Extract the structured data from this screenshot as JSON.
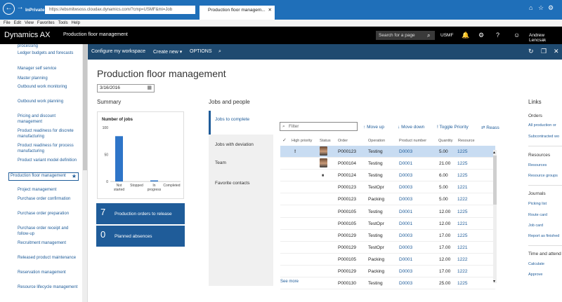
{
  "browser": {
    "inprivate": "InPrivate",
    "address": "https://ebsmitwsoss.cloudax.dynamics.com/?cmp=USMF&mi=Job",
    "tab_title": "Production floor managem...",
    "menu": [
      "File",
      "Edit",
      "View",
      "Favorites",
      "Tools",
      "Help"
    ]
  },
  "appnav": {
    "brand": "Dynamics AX",
    "page": "Production floor management",
    "search_placeholder": "Search for a page",
    "company": "USMF",
    "user": "Andrew Lencsak"
  },
  "actionpane": {
    "configure": "Configure my workspace",
    "create_new": "Create new",
    "options": "OPTIONS"
  },
  "leftnav": {
    "items": [
      "processing",
      "Ledger budgets and forecasts",
      "Manager self service",
      "Master planning",
      "Outbound work monitoring",
      "Outbound work planning",
      "Pricing and discount management",
      "Product readiness for discrete manufacturing",
      "Product readiness for process manufacturing",
      "Product variant model definition",
      "Production floor management",
      "Project management",
      "Purchase order confirmation",
      "Purchase order preparation",
      "Purchase order receipt and follow-up",
      "Recruitment management",
      "Released product maintenance",
      "Reservation management",
      "Resource lifecycle management"
    ]
  },
  "main": {
    "title": "Production floor management",
    "date": "3/16/2016",
    "summary_heading": "Summary",
    "jobs_and_people_heading": "Jobs and people"
  },
  "chart_data": {
    "type": "bar",
    "title": "Number of jobs",
    "categories": [
      "Not started",
      "Stopped",
      "In progress",
      "Completed"
    ],
    "values": [
      84,
      0,
      2,
      0
    ],
    "ylim": [
      0,
      100
    ],
    "yticks": [
      0,
      50,
      100
    ],
    "xlabel": "",
    "ylabel": "",
    "color": "#2e75c8"
  },
  "tiles": [
    {
      "count": "7",
      "label": "Production orders to release"
    },
    {
      "count": "0",
      "label": "Planned absences"
    }
  ],
  "jp_tabs": [
    "Jobs to complete",
    "Jobs with deviation",
    "Team",
    "Favorite contacts"
  ],
  "grid": {
    "filter_placeholder": "Filter",
    "actions": {
      "move_up": "Move up",
      "move_down": "Move down",
      "toggle_priority": "Toggle Priority",
      "reassign": "Reass"
    },
    "columns": [
      "High priority",
      "Status",
      "Order",
      "Operation",
      "Product number",
      "Quantity",
      "Resource"
    ],
    "rows": [
      {
        "priority": "!",
        "status": "avatar",
        "order": "P000123",
        "operation": "Testing",
        "product": "D0003",
        "qty": "5.00",
        "resource": "1225"
      },
      {
        "priority": "",
        "status": "avatar",
        "order": "P000104",
        "operation": "Testing",
        "product": "D0001",
        "qty": "21.00",
        "resource": "1225"
      },
      {
        "priority": "",
        "status": "pause",
        "order": "P000124",
        "operation": "Testing",
        "product": "D0003",
        "qty": "6.00",
        "resource": "1225"
      },
      {
        "priority": "",
        "status": "",
        "order": "P000123",
        "operation": "TestOpr",
        "product": "D0003",
        "qty": "5.00",
        "resource": "1221"
      },
      {
        "priority": "",
        "status": "",
        "order": "P000123",
        "operation": "Packing",
        "product": "D0003",
        "qty": "5.00",
        "resource": "1222"
      },
      {
        "priority": "",
        "status": "",
        "order": "P000105",
        "operation": "Testing",
        "product": "D0001",
        "qty": "12.00",
        "resource": "1225"
      },
      {
        "priority": "",
        "status": "",
        "order": "P000105",
        "operation": "TestOpr",
        "product": "D0001",
        "qty": "12.00",
        "resource": "1221"
      },
      {
        "priority": "",
        "status": "",
        "order": "P000129",
        "operation": "Testing",
        "product": "D0003",
        "qty": "17.00",
        "resource": "1225"
      },
      {
        "priority": "",
        "status": "",
        "order": "P000129",
        "operation": "TestOpr",
        "product": "D0003",
        "qty": "17.00",
        "resource": "1221"
      },
      {
        "priority": "",
        "status": "",
        "order": "P000105",
        "operation": "Packing",
        "product": "D0001",
        "qty": "12.00",
        "resource": "1222"
      },
      {
        "priority": "",
        "status": "",
        "order": "P000129",
        "operation": "Packing",
        "product": "D0003",
        "qty": "17.00",
        "resource": "1222"
      },
      {
        "priority": "",
        "status": "",
        "order": "P000130",
        "operation": "Testing",
        "product": "D0003",
        "qty": "25.00",
        "resource": "1225"
      }
    ],
    "see_more": "See more"
  },
  "links": {
    "heading": "Links",
    "orders_h": "Orders",
    "orders": [
      "All production or",
      "Subcontracted wo"
    ],
    "resources_h": "Resources",
    "resources": [
      "Resources",
      "Resource groups"
    ],
    "journals_h": "Journals",
    "journals": [
      "Picking list",
      "Route card",
      "Job card",
      "Report as finished"
    ],
    "time_h": "Time and attend",
    "time": [
      "Calculate",
      "Approve"
    ]
  }
}
